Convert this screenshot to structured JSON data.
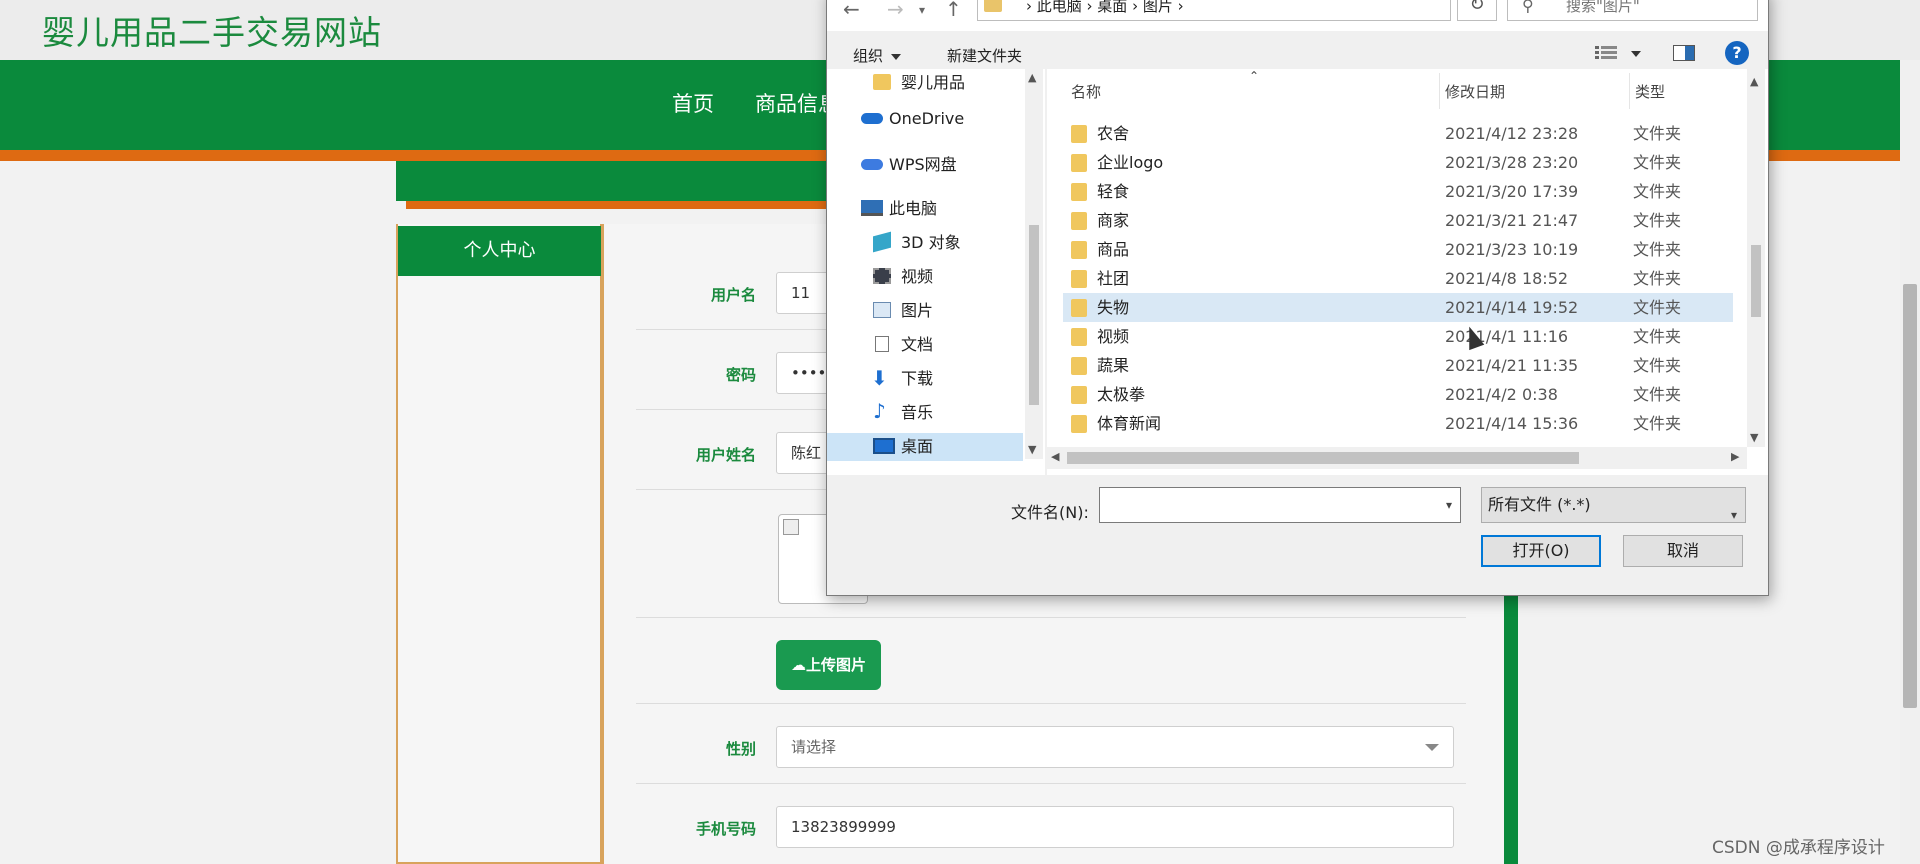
{
  "site": {
    "title": "婴儿用品二手交易网站",
    "nav": [
      "首页",
      "商品信息"
    ],
    "side_tab": "个人中心",
    "watermark": "CSDN @成承程序设计"
  },
  "form": {
    "username_label": "用户名",
    "username_value": "11",
    "password_label": "密码",
    "password_value": "••••••",
    "realname_label": "用户姓名",
    "realname_value": "陈红",
    "upload_label": "上传图片",
    "gender_label": "性别",
    "gender_value": "请选择",
    "phone_label": "手机号码",
    "phone_value": "13823899999"
  },
  "dialog": {
    "breadcrumb": "› 此电脑 › 桌面 › 图片 ›",
    "search_placeholder": "搜索\"图片\"",
    "organize_label": "组织",
    "new_folder_label": "新建文件夹",
    "nav_items": [
      {
        "label": "婴儿用品",
        "icon": "folder-icon"
      },
      {
        "label": "OneDrive",
        "icon": "cloud-icon"
      },
      {
        "label": "WPS网盘",
        "icon": "cloud-icon"
      },
      {
        "label": "此电脑",
        "icon": "computer-icon"
      },
      {
        "label": "3D 对象",
        "icon": "cube-icon"
      },
      {
        "label": "视频",
        "icon": "video-icon"
      },
      {
        "label": "图片",
        "icon": "picture-icon"
      },
      {
        "label": "文档",
        "icon": "document-icon"
      },
      {
        "label": "下载",
        "icon": "download-icon"
      },
      {
        "label": "音乐",
        "icon": "music-icon"
      },
      {
        "label": "桌面",
        "icon": "desktop-icon"
      }
    ],
    "columns": {
      "name": "名称",
      "date": "修改日期",
      "type": "类型"
    },
    "files": [
      {
        "name": "农舍",
        "date": "2021/4/12 23:28",
        "type": "文件夹"
      },
      {
        "name": "企业logo",
        "date": "2021/3/28 23:20",
        "type": "文件夹"
      },
      {
        "name": "轻食",
        "date": "2021/3/20 17:39",
        "type": "文件夹"
      },
      {
        "name": "商家",
        "date": "2021/3/21 21:47",
        "type": "文件夹"
      },
      {
        "name": "商品",
        "date": "2021/3/23 10:19",
        "type": "文件夹"
      },
      {
        "name": "社团",
        "date": "2021/4/8 18:52",
        "type": "文件夹"
      },
      {
        "name": "失物",
        "date": "2021/4/14 19:52",
        "type": "文件夹"
      },
      {
        "name": "视频",
        "date": "2021/4/1 11:16",
        "type": "文件夹"
      },
      {
        "name": "蔬果",
        "date": "2021/4/21 11:35",
        "type": "文件夹"
      },
      {
        "name": "太极拳",
        "date": "2021/4/2 0:38",
        "type": "文件夹"
      },
      {
        "name": "体育新闻",
        "date": "2021/4/14 15:36",
        "type": "文件夹"
      }
    ],
    "filename_label": "文件名(N):",
    "filename_value": "",
    "filetype_value": "所有文件 (*.*)",
    "open_label": "打开(O)",
    "cancel_label": "取消"
  }
}
